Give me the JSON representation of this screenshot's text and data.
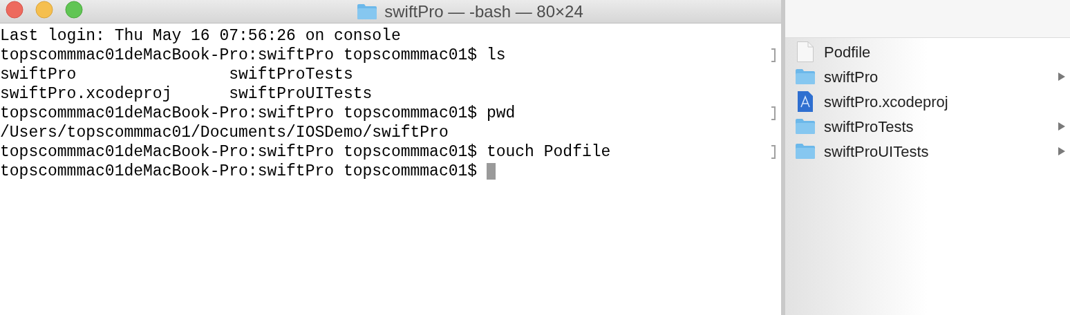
{
  "terminal": {
    "title": "swiftPro — -bash — 80×24",
    "lines": [
      {
        "text": "Last login: Thu May 16 07:56:26 on console",
        "marked": false
      },
      {
        "text": "topscommmac01deMacBook-Pro:swiftPro topscommmac01$ ls",
        "marked": true
      },
      {
        "text": "swiftPro                swiftProTests",
        "marked": false
      },
      {
        "text": "swiftPro.xcodeproj      swiftProUITests",
        "marked": false
      },
      {
        "text": "topscommmac01deMacBook-Pro:swiftPro topscommmac01$ pwd",
        "marked": true
      },
      {
        "text": "/Users/topscommmac01/Documents/IOSDemo/swiftPro",
        "marked": false
      },
      {
        "text": "topscommmac01deMacBook-Pro:swiftPro topscommmac01$ touch Podfile",
        "marked": true
      },
      {
        "text": "topscommmac01deMacBook-Pro:swiftPro topscommmac01$ ",
        "marked": false,
        "cursor": true
      }
    ]
  },
  "finder": {
    "items": [
      {
        "name": "Podfile",
        "kind": "file",
        "has_children": false
      },
      {
        "name": "swiftPro",
        "kind": "folder",
        "has_children": true
      },
      {
        "name": "swiftPro.xcodeproj",
        "kind": "project",
        "has_children": false
      },
      {
        "name": "swiftProTests",
        "kind": "folder",
        "has_children": true
      },
      {
        "name": "swiftProUITests",
        "kind": "folder",
        "has_children": true
      }
    ]
  }
}
